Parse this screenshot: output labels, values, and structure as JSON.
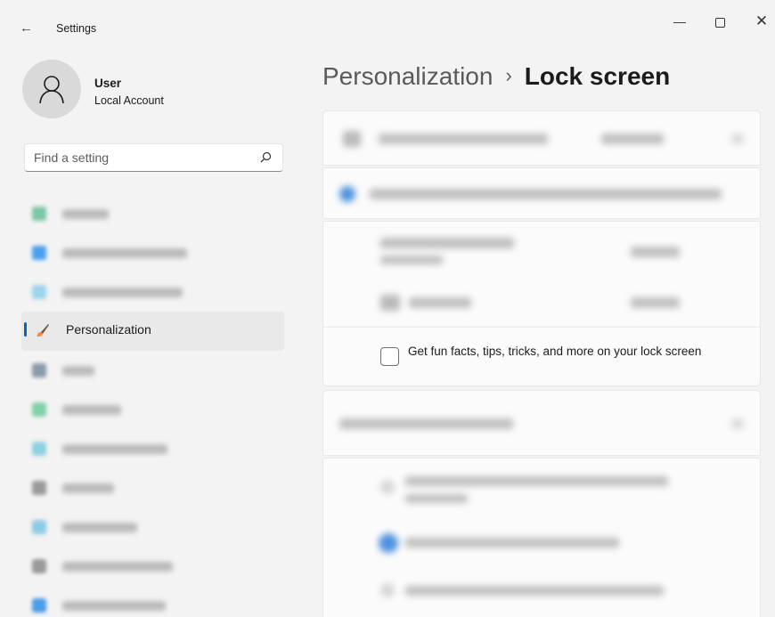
{
  "window": {
    "back_glyph": "←",
    "title": "Settings",
    "minimize_glyph": "—",
    "close_glyph": "✕"
  },
  "user": {
    "name": "User",
    "account_type": "Local Account"
  },
  "search": {
    "placeholder": "Find a setting"
  },
  "sidebar": {
    "items": [
      {
        "label": "",
        "icon": "home-icon",
        "icon_color": "#7cc6a4",
        "blurred": true
      },
      {
        "label": "",
        "icon": "bluetooth-icon",
        "icon_color": "#4aa0f0",
        "blurred": true
      },
      {
        "label": "",
        "icon": "network-icon",
        "icon_color": "#9ed4ec",
        "blurred": true
      },
      {
        "label": "Personalization",
        "icon": "brush-icon",
        "selected": true
      },
      {
        "label": "",
        "icon": "apps-icon",
        "icon_color": "#8a9aaa",
        "blurred": true
      },
      {
        "label": "",
        "icon": "accounts-icon",
        "icon_color": "#7fd1a8",
        "blurred": true
      },
      {
        "label": "",
        "icon": "time-language-icon",
        "icon_color": "#8fd0e0",
        "blurred": true
      },
      {
        "label": "",
        "icon": "gaming-icon",
        "icon_color": "#9a9a9a",
        "blurred": true
      },
      {
        "label": "",
        "icon": "accessibility-icon",
        "icon_color": "#8fcbe8",
        "blurred": true
      },
      {
        "label": "",
        "icon": "privacy-icon",
        "icon_color": "#999999",
        "blurred": true
      },
      {
        "label": "",
        "icon": "windows-update-icon",
        "icon_color": "#4a9be8",
        "blurred": true
      }
    ]
  },
  "header": {
    "parent": "Personalization",
    "separator": "›",
    "current": "Lock screen"
  },
  "lock_screen": {
    "tips_checkbox": {
      "label": "Get fun facts, tips, tricks, and more on your lock screen",
      "checked": false
    }
  },
  "colors": {
    "accent": "#0067c0",
    "background": "#f3f3f3",
    "card": "#fbfbfb"
  }
}
